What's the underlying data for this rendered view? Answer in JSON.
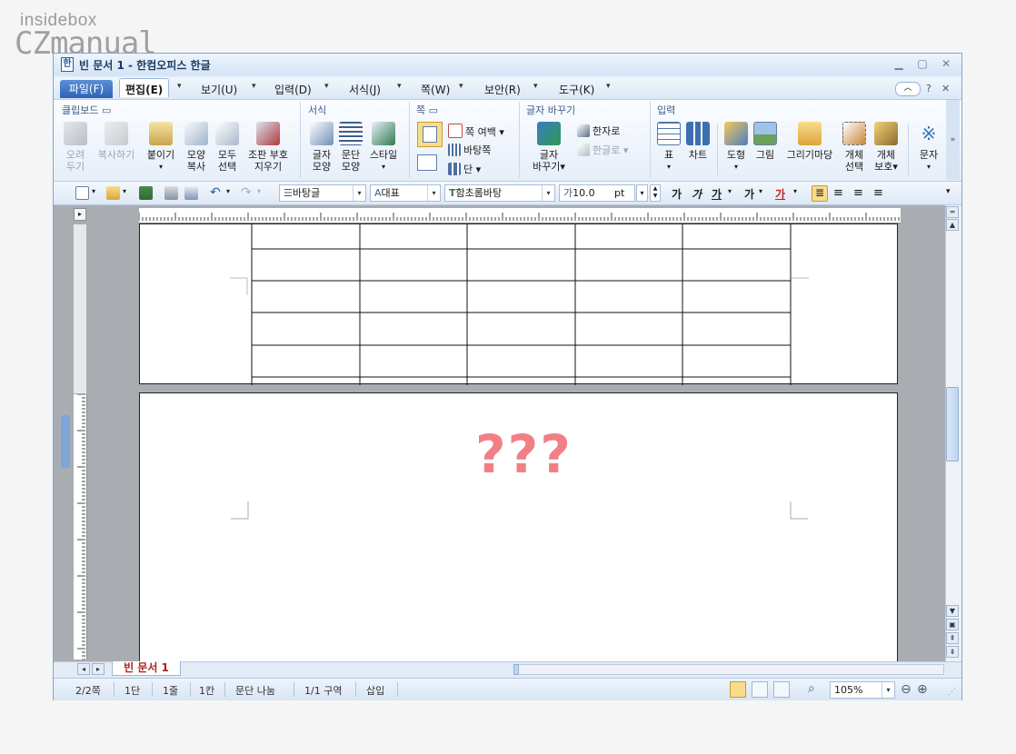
{
  "watermark": {
    "line1": "insidebox",
    "line2": "CZmanual"
  },
  "window": {
    "title": "빈 문서 1 - 한컴오피스 한글"
  },
  "menubar": {
    "file": "파일(F)",
    "items": [
      "편집(E)",
      "보기(U)",
      "입력(D)",
      "서식(J)",
      "쪽(W)",
      "보안(R)",
      "도구(K)"
    ]
  },
  "ribbon": {
    "groups": {
      "clipboard": "클립보드",
      "format": "서식",
      "page": "쪽",
      "convert": "글자 바꾸기",
      "insert": "입력"
    },
    "buttons": {
      "cut": [
        "오려",
        "두기"
      ],
      "copy": "복사하기",
      "paste": "붙이기",
      "format_copy": [
        "모양",
        "복사"
      ],
      "select_all": [
        "모두",
        "선택"
      ],
      "clear_mark": [
        "조판 부호",
        "지우기"
      ],
      "char_shape": [
        "글자",
        "모양"
      ],
      "para_shape": [
        "문단",
        "모양"
      ],
      "style": "스타일",
      "page_margin": "쪽 여백",
      "master_page": "바탕쪽",
      "column": "단",
      "convert_char": [
        "글자",
        "바꾸기"
      ],
      "to_hanja": "한자로",
      "to_hangul": "한글로",
      "table": "표",
      "chart": "차트",
      "shape": "도형",
      "picture": "그림",
      "gallery": "그리기마당",
      "obj_select": [
        "개체",
        "선택"
      ],
      "obj_protect": [
        "개체",
        "보호"
      ],
      "char": "문자"
    }
  },
  "toolbar": {
    "style": "바탕글",
    "lang": "대표",
    "font": "함초롬바탕",
    "size": "10.0",
    "unit": "pt",
    "fmt": [
      "가",
      "가",
      "가",
      "가",
      "가"
    ]
  },
  "document": {
    "overlay_text": "???"
  },
  "tabs": {
    "doc_tab": "빈 문서 1"
  },
  "status": {
    "page": "2/2쪽",
    "col": "1단",
    "line": "1줄",
    "cell": "1칸",
    "para": "문단 나눔",
    "section": "1/1 구역",
    "mode": "삽입",
    "zoom": "105%"
  },
  "colors": {
    "accent": "#2e63b8",
    "overlay": "#f27f86"
  }
}
